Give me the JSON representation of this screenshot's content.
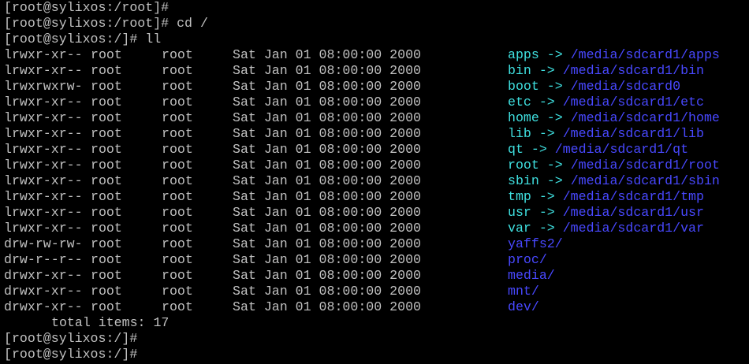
{
  "prompt_lines": [
    "[root@sylixos:/root]#",
    "[root@sylixos:/root]# cd /",
    "[root@sylixos:/]# ll"
  ],
  "listing": [
    {
      "perm": "lrwxr-xr--",
      "user": "root",
      "group": "root",
      "date": "Sat Jan 01 08:00:00 2000",
      "name": "apps",
      "arrow": " -> ",
      "target": "/media/sdcard1/apps",
      "kind": "link"
    },
    {
      "perm": "lrwxr-xr--",
      "user": "root",
      "group": "root",
      "date": "Sat Jan 01 08:00:00 2000",
      "name": "bin",
      "arrow": " -> ",
      "target": "/media/sdcard1/bin",
      "kind": "link"
    },
    {
      "perm": "lrwxrwxrw-",
      "user": "root",
      "group": "root",
      "date": "Sat Jan 01 08:00:00 2000",
      "name": "boot",
      "arrow": " -> ",
      "target": "/media/sdcard0",
      "kind": "link"
    },
    {
      "perm": "lrwxr-xr--",
      "user": "root",
      "group": "root",
      "date": "Sat Jan 01 08:00:00 2000",
      "name": "etc",
      "arrow": " -> ",
      "target": "/media/sdcard1/etc",
      "kind": "link"
    },
    {
      "perm": "lrwxr-xr--",
      "user": "root",
      "group": "root",
      "date": "Sat Jan 01 08:00:00 2000",
      "name": "home",
      "arrow": " -> ",
      "target": "/media/sdcard1/home",
      "kind": "link"
    },
    {
      "perm": "lrwxr-xr--",
      "user": "root",
      "group": "root",
      "date": "Sat Jan 01 08:00:00 2000",
      "name": "lib",
      "arrow": " -> ",
      "target": "/media/sdcard1/lib",
      "kind": "link"
    },
    {
      "perm": "lrwxr-xr--",
      "user": "root",
      "group": "root",
      "date": "Sat Jan 01 08:00:00 2000",
      "name": "qt",
      "arrow": " -> ",
      "target": "/media/sdcard1/qt",
      "kind": "link"
    },
    {
      "perm": "lrwxr-xr--",
      "user": "root",
      "group": "root",
      "date": "Sat Jan 01 08:00:00 2000",
      "name": "root",
      "arrow": " -> ",
      "target": "/media/sdcard1/root",
      "kind": "link"
    },
    {
      "perm": "lrwxr-xr--",
      "user": "root",
      "group": "root",
      "date": "Sat Jan 01 08:00:00 2000",
      "name": "sbin",
      "arrow": " -> ",
      "target": "/media/sdcard1/sbin",
      "kind": "link"
    },
    {
      "perm": "lrwxr-xr--",
      "user": "root",
      "group": "root",
      "date": "Sat Jan 01 08:00:00 2000",
      "name": "tmp",
      "arrow": " -> ",
      "target": "/media/sdcard1/tmp",
      "kind": "link"
    },
    {
      "perm": "lrwxr-xr--",
      "user": "root",
      "group": "root",
      "date": "Sat Jan 01 08:00:00 2000",
      "name": "usr",
      "arrow": " -> ",
      "target": "/media/sdcard1/usr",
      "kind": "link"
    },
    {
      "perm": "lrwxr-xr--",
      "user": "root",
      "group": "root",
      "date": "Sat Jan 01 08:00:00 2000",
      "name": "var",
      "arrow": " -> ",
      "target": "/media/sdcard1/var",
      "kind": "link"
    },
    {
      "perm": "drw-rw-rw-",
      "user": "root",
      "group": "root",
      "date": "Sat Jan 01 08:00:00 2000",
      "name": "yaffs2/",
      "arrow": "",
      "target": "",
      "kind": "dir"
    },
    {
      "perm": "drw-r--r--",
      "user": "root",
      "group": "root",
      "date": "Sat Jan 01 08:00:00 2000",
      "name": "proc/",
      "arrow": "",
      "target": "",
      "kind": "dir"
    },
    {
      "perm": "drwxr-xr--",
      "user": "root",
      "group": "root",
      "date": "Sat Jan 01 08:00:00 2000",
      "name": "media/",
      "arrow": "",
      "target": "",
      "kind": "dir"
    },
    {
      "perm": "drwxr-xr--",
      "user": "root",
      "group": "root",
      "date": "Sat Jan 01 08:00:00 2000",
      "name": "mnt/",
      "arrow": "",
      "target": "",
      "kind": "dir"
    },
    {
      "perm": "drwxr-xr--",
      "user": "root",
      "group": "root",
      "date": "Sat Jan 01 08:00:00 2000",
      "name": "dev/",
      "arrow": "",
      "target": "",
      "kind": "dir"
    }
  ],
  "total_line": "total items: 17",
  "trailing_prompts": [
    "[root@sylixos:/]#",
    "[root@sylixos:/]#"
  ],
  "colors": {
    "background": "#000000",
    "text": "#c0c0c0",
    "link_name": "#3fe0e0",
    "link_target": "#4848ff",
    "directory": "#4848ff"
  }
}
